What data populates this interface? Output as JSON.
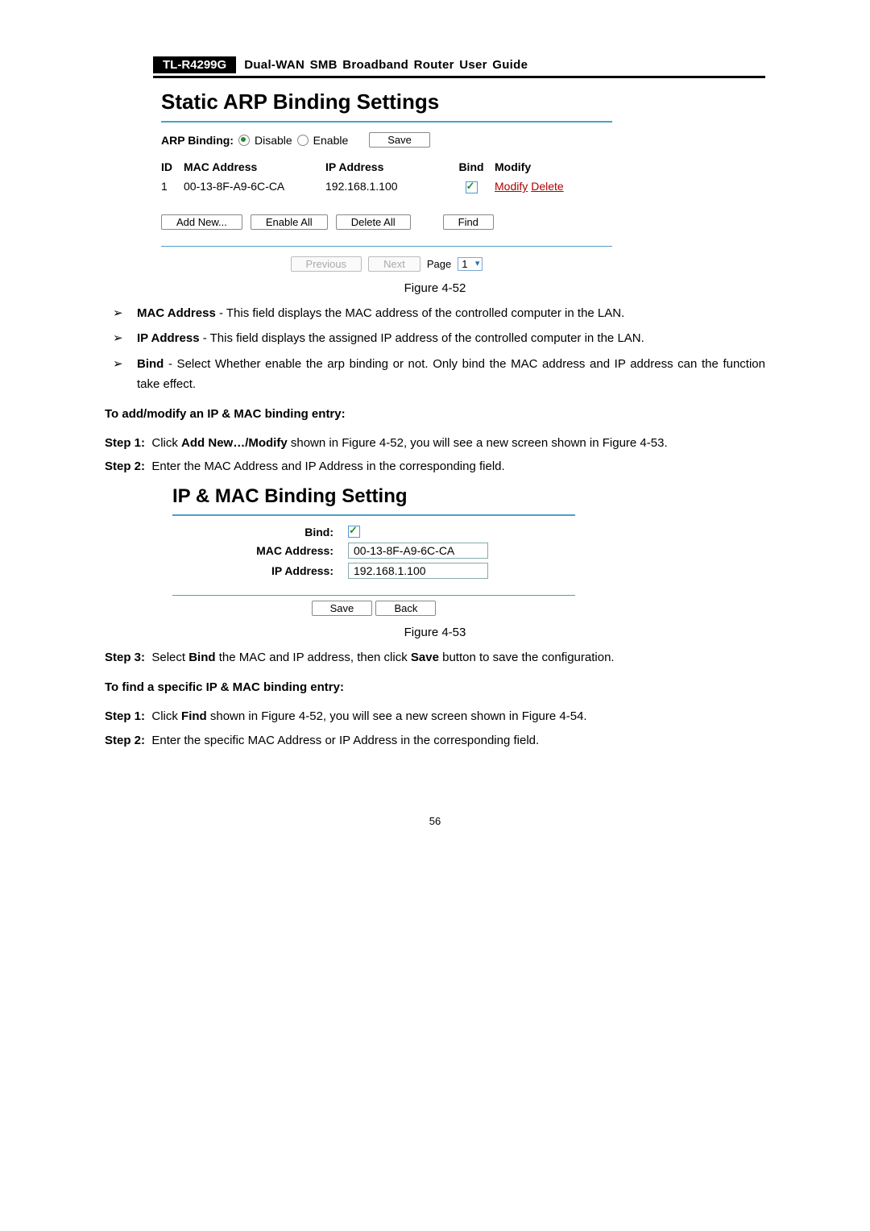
{
  "header": {
    "model": "TL-R4299G",
    "title": "Dual-WAN SMB Broadband Router User Guide"
  },
  "panel1": {
    "title": "Static ARP Binding Settings",
    "arp_label": "ARP Binding:",
    "opt_disable": "Disable",
    "opt_enable": "Enable",
    "save_btn": "Save",
    "head_id": "ID",
    "head_mac": "MAC Address",
    "head_ip": "IP Address",
    "head_bind": "Bind",
    "head_modify": "Modify",
    "rows": [
      {
        "id": "1",
        "mac": "00-13-8F-A9-6C-CA",
        "ip": "192.168.1.100"
      }
    ],
    "link_modify": "Modify",
    "link_delete": "Delete",
    "btn_addnew": "Add New...",
    "btn_enableall": "Enable All",
    "btn_deleteall": "Delete All",
    "btn_find": "Find",
    "btn_previous": "Previous",
    "btn_next": "Next",
    "page_label": "Page",
    "page_value": "1"
  },
  "caption1": "Figure 4-52",
  "bullets": [
    {
      "term": "MAC Address",
      "text": " - This field displays the MAC address of the controlled computer in the LAN."
    },
    {
      "term": "IP Address",
      "text": " - This field displays the assigned IP address of the controlled computer in the LAN."
    },
    {
      "term": "Bind",
      "text": " - Select Whether enable the arp binding or not. Only bind the MAC address and IP address can the function take effect."
    }
  ],
  "section_addmodify": "To add/modify an IP & MAC binding entry:",
  "step1_a": "Step 1:",
  "step1_b": "Click ",
  "step1_c": "Add New…/Modify",
  "step1_d": " shown in Figure 4-52, you will see a new screen shown in Figure 4-53.",
  "step2_a": "Step 2:",
  "step2_b": "Enter the MAC Address and IP Address in the corresponding field.",
  "panel2": {
    "title": "IP & MAC Binding Setting",
    "lab_bind": "Bind:",
    "lab_mac": "MAC Address:",
    "lab_ip": "IP Address:",
    "val_mac": "00-13-8F-A9-6C-CA",
    "val_ip": "192.168.1.100",
    "btn_save": "Save",
    "btn_back": "Back"
  },
  "caption2": "Figure 4-53",
  "step3_a": "Step 3:",
  "step3_b": "Select ",
  "step3_c": "Bind",
  "step3_d": " the MAC and IP address, then click ",
  "step3_e": "Save",
  "step3_f": " button to save the configuration.",
  "section_find": "To find a specific IP & MAC binding entry:",
  "find_step1_a": "Step 1:",
  "find_step1_b": "Click ",
  "find_step1_c": "Find",
  "find_step1_d": " shown in Figure 4-52, you will see a new screen shown in Figure 4-54.",
  "find_step2_a": "Step 2:",
  "find_step2_b": "Enter the specific MAC Address or IP Address in the corresponding field.",
  "page_number": "56"
}
